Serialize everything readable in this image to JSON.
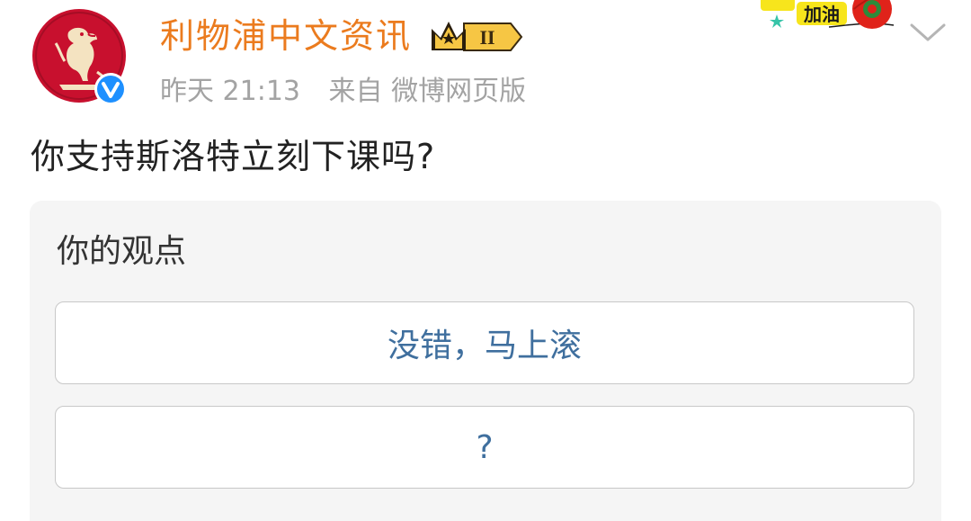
{
  "author": {
    "name": "利物浦中文资讯",
    "vip_level": "II"
  },
  "meta": {
    "time": "昨天 21:13",
    "source": "来自 微博网页版"
  },
  "decor": {
    "text": "加油"
  },
  "post": {
    "text": "你支持斯洛特立刻下课吗?"
  },
  "vote": {
    "title": "你的观点",
    "options": [
      {
        "label": "没错，马上滚"
      },
      {
        "label": "?"
      }
    ]
  },
  "icons": {
    "avatar": "liverbird-logo",
    "verified": "verified-v-icon",
    "vip": "crown-vip-badge-icon",
    "more": "chevron-down-icon"
  },
  "colors": {
    "author_name": "#eb7b1e",
    "avatar_red": "#c8102e",
    "verified_blue": "#1e90ff",
    "option_text": "#3f6f9e",
    "card_bg": "#f5f5f5"
  }
}
